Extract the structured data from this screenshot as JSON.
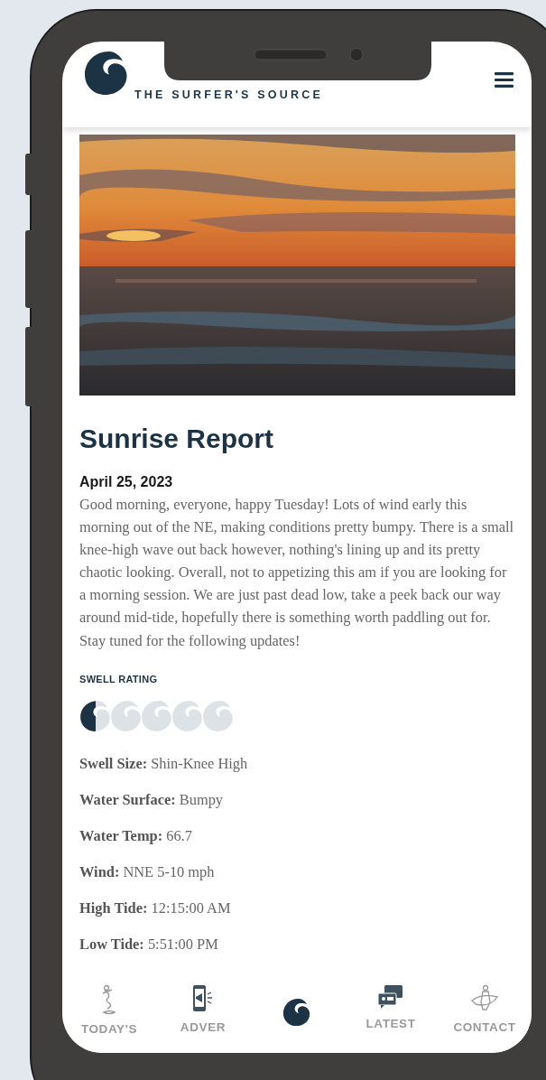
{
  "header": {
    "tagline": "THE SURFER'S SOURCE"
  },
  "report": {
    "title": "Sunrise Report",
    "date": "April 25, 2023",
    "body": "Good morning, everyone, happy Tuesday! Lots of wind early this morning out of the NE, making conditions pretty bumpy. There is a small knee-high wave out back however, nothing's lining up and its pretty chaotic looking. Overall, not to appetizing this am if you are looking for a morning session. We are just past dead low, take a peek back our way around mid-tide, hopefully there is something worth paddling out for. Stay tuned for the following updates!",
    "rating_label": "SWELL RATING",
    "rating": {
      "stars": 0.5
    },
    "details": [
      {
        "label": "Swell Size:",
        "value": "Shin-Knee High"
      },
      {
        "label": "Water Surface:",
        "value": "Bumpy"
      },
      {
        "label": "Water Temp:",
        "value": "66.7"
      },
      {
        "label": "Wind:",
        "value": "NNE 5-10 mph"
      },
      {
        "label": "High Tide:",
        "value": "12:15:00 AM"
      },
      {
        "label": "Low Tide:",
        "value": "5:51:00 PM"
      }
    ]
  },
  "bottom_nav": [
    {
      "label": "TODAY'S",
      "selected": false
    },
    {
      "label": "ADVER",
      "selected": false
    },
    {
      "selected": true
    },
    {
      "label": "LATEST",
      "selected": false
    },
    {
      "label": "CONTACT",
      "selected": false
    }
  ]
}
